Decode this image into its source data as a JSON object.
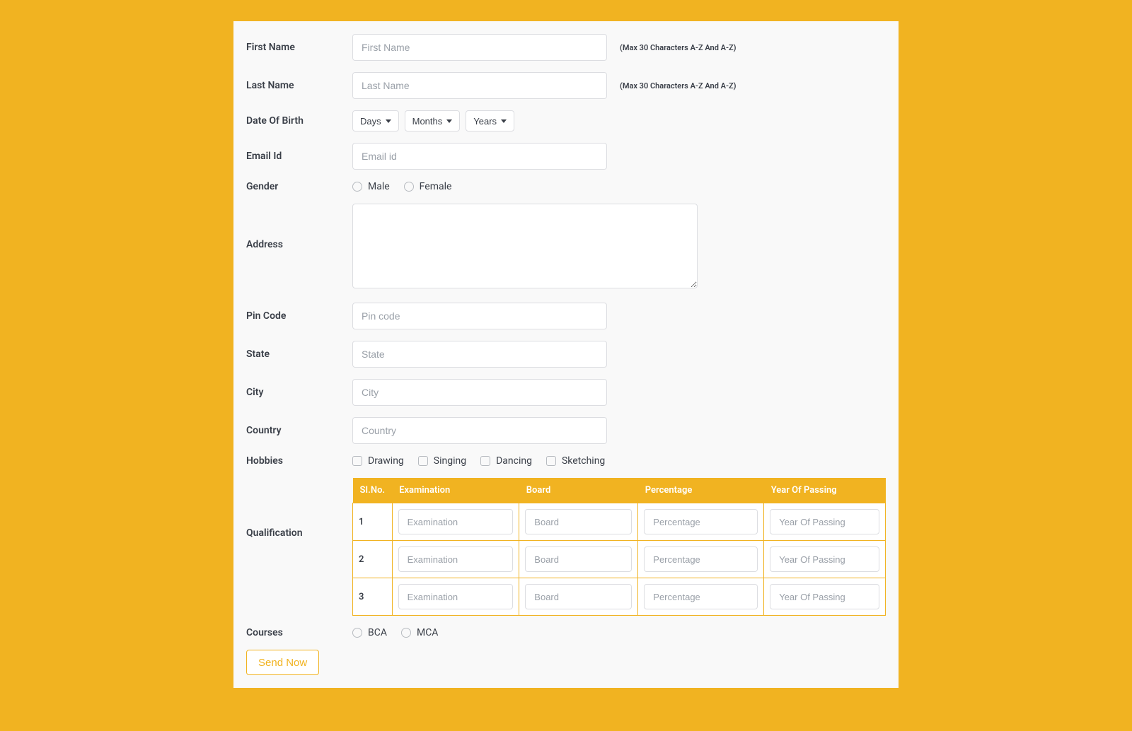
{
  "labels": {
    "firstName": "First Name",
    "lastName": "Last Name",
    "dob": "Date Of Birth",
    "email": "Email Id",
    "gender": "Gender",
    "address": "Address",
    "pinCode": "Pin Code",
    "state": "State",
    "city": "City",
    "country": "Country",
    "hobbies": "Hobbies",
    "qualification": "Qualification",
    "courses": "Courses"
  },
  "placeholders": {
    "firstName": "First Name",
    "lastName": "Last Name",
    "email": "Email id",
    "pinCode": "Pin code",
    "state": "State",
    "city": "City",
    "country": "Country",
    "examination": "Examination",
    "board": "Board",
    "percentage": "Percentage",
    "yearOfPassing": "Year Of Passing"
  },
  "hints": {
    "nameLimit": "(Max 30 Characters A-Z And A-Z)"
  },
  "dob": {
    "days": "Days",
    "months": "Months",
    "years": "Years"
  },
  "gender": {
    "male": "Male",
    "female": "Female"
  },
  "hobbies": {
    "drawing": "Drawing",
    "singing": "Singing",
    "dancing": "Dancing",
    "sketching": "Sketching"
  },
  "qualification": {
    "headers": {
      "slno": "SI.No.",
      "examination": "Examination",
      "board": "Board",
      "percentage": "Percentage",
      "yearOfPassing": "Year Of Passing"
    },
    "rows": [
      "1",
      "2",
      "3"
    ]
  },
  "courses": {
    "bca": "BCA",
    "mca": "MCA"
  },
  "submitLabel": "Send Now"
}
